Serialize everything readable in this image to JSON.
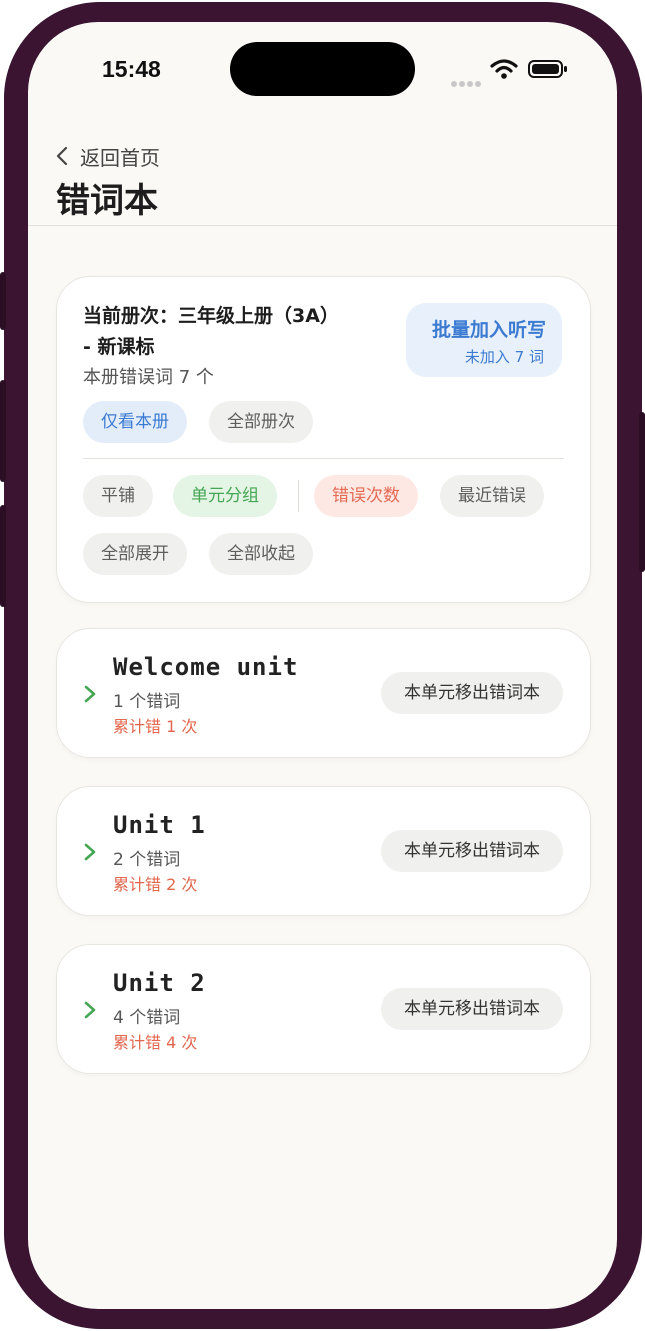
{
  "status_bar": {
    "time": "15:48"
  },
  "header": {
    "back_label": "返回首页",
    "title": "错词本"
  },
  "summary": {
    "volume_label": "当前册次：",
    "volume_value": "三年级上册（3A）",
    "volume_suffix": "- 新课标",
    "error_count": "本册错误词 7 个",
    "batch_title": "批量加入听写",
    "batch_sub": "未加入 7 词",
    "scope_chips": [
      "仅看本册",
      "全部册次"
    ],
    "view_chips": [
      "平铺",
      "单元分组"
    ],
    "sort_chips": [
      "错误次数",
      "最近错误"
    ],
    "expand_chips": [
      "全部展开",
      "全部收起"
    ]
  },
  "units": [
    {
      "name": "Welcome unit",
      "words": "1 个错词",
      "errors": "累计错 1 次",
      "action": "本单元移出错词本"
    },
    {
      "name": "Unit 1",
      "words": "2 个错词",
      "errors": "累计错 2 次",
      "action": "本单元移出错词本"
    },
    {
      "name": "Unit 2",
      "words": "4 个错词",
      "errors": "累计错 4 次",
      "action": "本单元移出错词本"
    }
  ],
  "colors": {
    "accent_blue": "#3b7bd1",
    "accent_green": "#45a654",
    "accent_red": "#e56a52",
    "frame": "#3a1430"
  }
}
